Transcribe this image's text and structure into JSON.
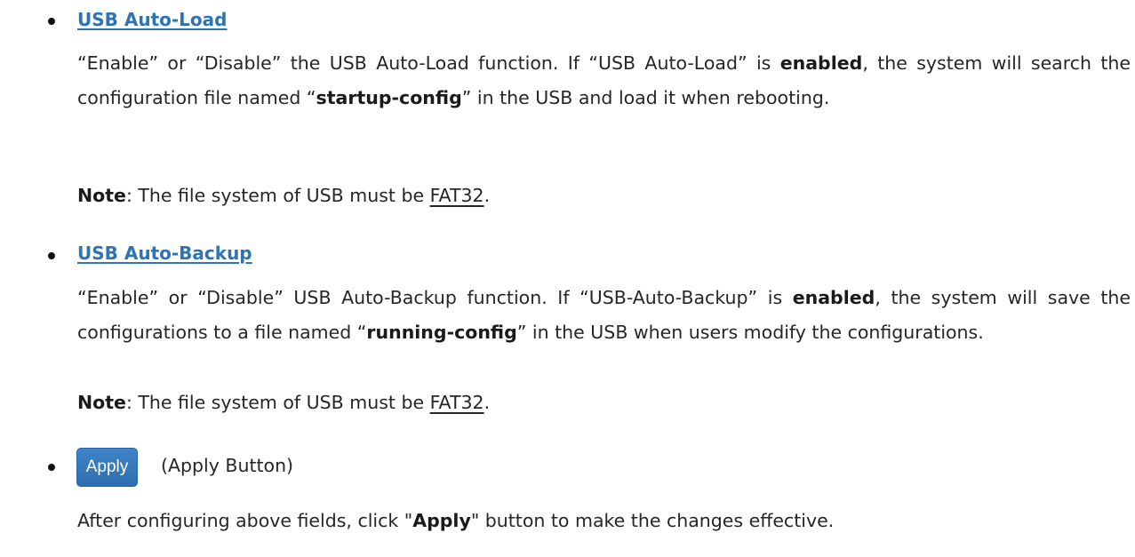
{
  "sections": [
    {
      "heading": "USB Auto-Load",
      "p1": "“Enable” or “Disable” the USB Auto-Load function. If “USB Auto-Load” is ",
      "p1_bold": "enabled",
      "p2": ", the system will search the configuration file named “",
      "p2_bold": "startup-config",
      "p3": "” in the USB and load it when rebooting.",
      "note_label": "Note",
      "note_text": ": The file system of USB must be ",
      "note_fs": "FAT32",
      "note_end": "."
    },
    {
      "heading": "USB Auto-Backup",
      "p1": "“Enable” or “Disable” USB Auto-Backup function. If “USB-Auto-Backup” is ",
      "p1_bold": "enabled",
      "p2": ", the system will save the configurations to a file named “",
      "p2_bold": "running-config",
      "p3": "” in the USB when users modify the configurations.",
      "note_label": "Note",
      "note_text": ": The file system of USB must be ",
      "note_fs": "FAT32",
      "note_end": "."
    }
  ],
  "apply": {
    "button_label": "Apply",
    "description": "(Apply Button)",
    "final_pre": "After configuring above fields, click \"",
    "final_bold": "Apply",
    "final_post": "\" button to make the changes effective."
  }
}
